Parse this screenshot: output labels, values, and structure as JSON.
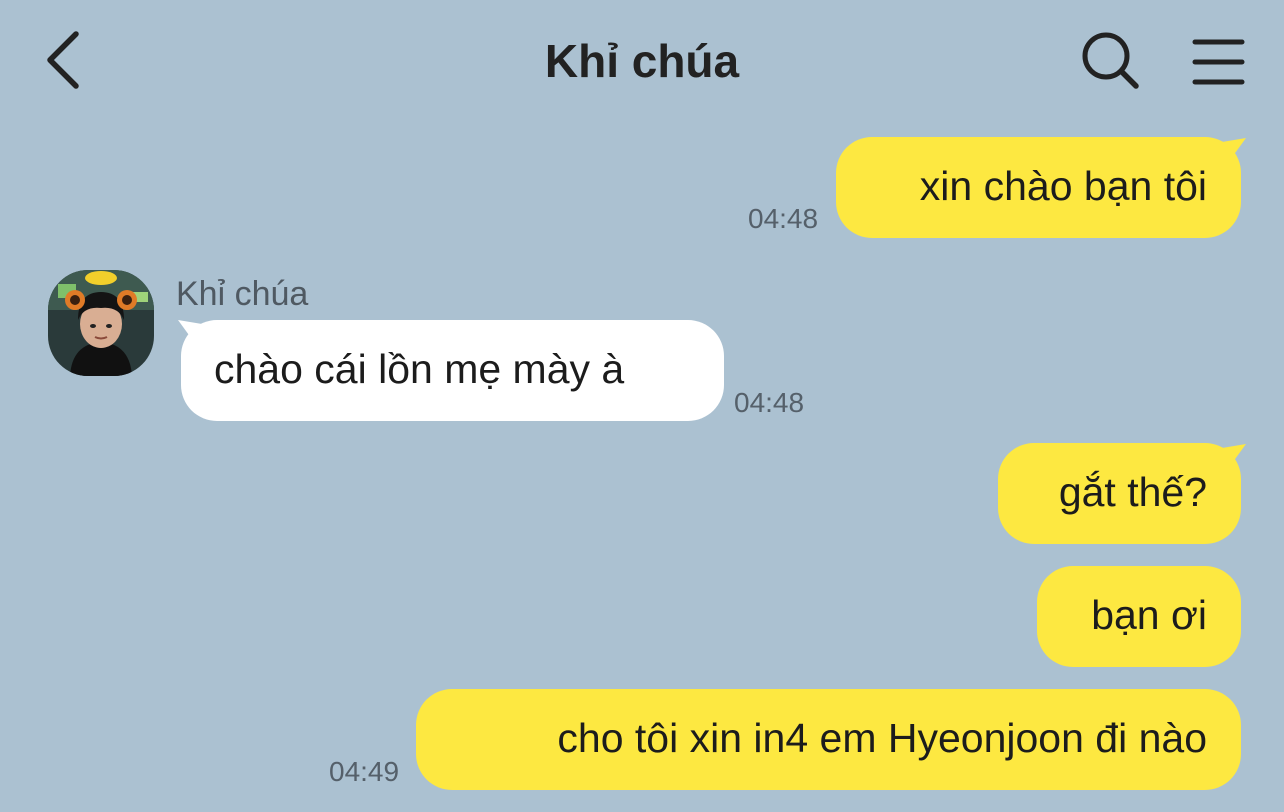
{
  "header": {
    "title": "Khỉ chúa",
    "back_icon": "chevron-left-icon",
    "search_icon": "search-icon",
    "menu_icon": "menu-icon"
  },
  "colors": {
    "background": "#abc1d1",
    "outgoing_bubble": "#fde841",
    "incoming_bubble": "#ffffff"
  },
  "messages": [
    {
      "direction": "outgoing",
      "text": "xin chào bạn tôi",
      "time": "04:48"
    },
    {
      "direction": "incoming",
      "sender": "Khỉ chúa",
      "text": "chào cái lồn mẹ mày à",
      "time": "04:48"
    },
    {
      "direction": "outgoing",
      "text": "gắt thế?",
      "time": ""
    },
    {
      "direction": "outgoing",
      "text": "bạn ơi",
      "time": ""
    },
    {
      "direction": "outgoing",
      "text": "cho tôi xin in4 em Hyeonjoon đi nào",
      "time": "04:49"
    }
  ]
}
